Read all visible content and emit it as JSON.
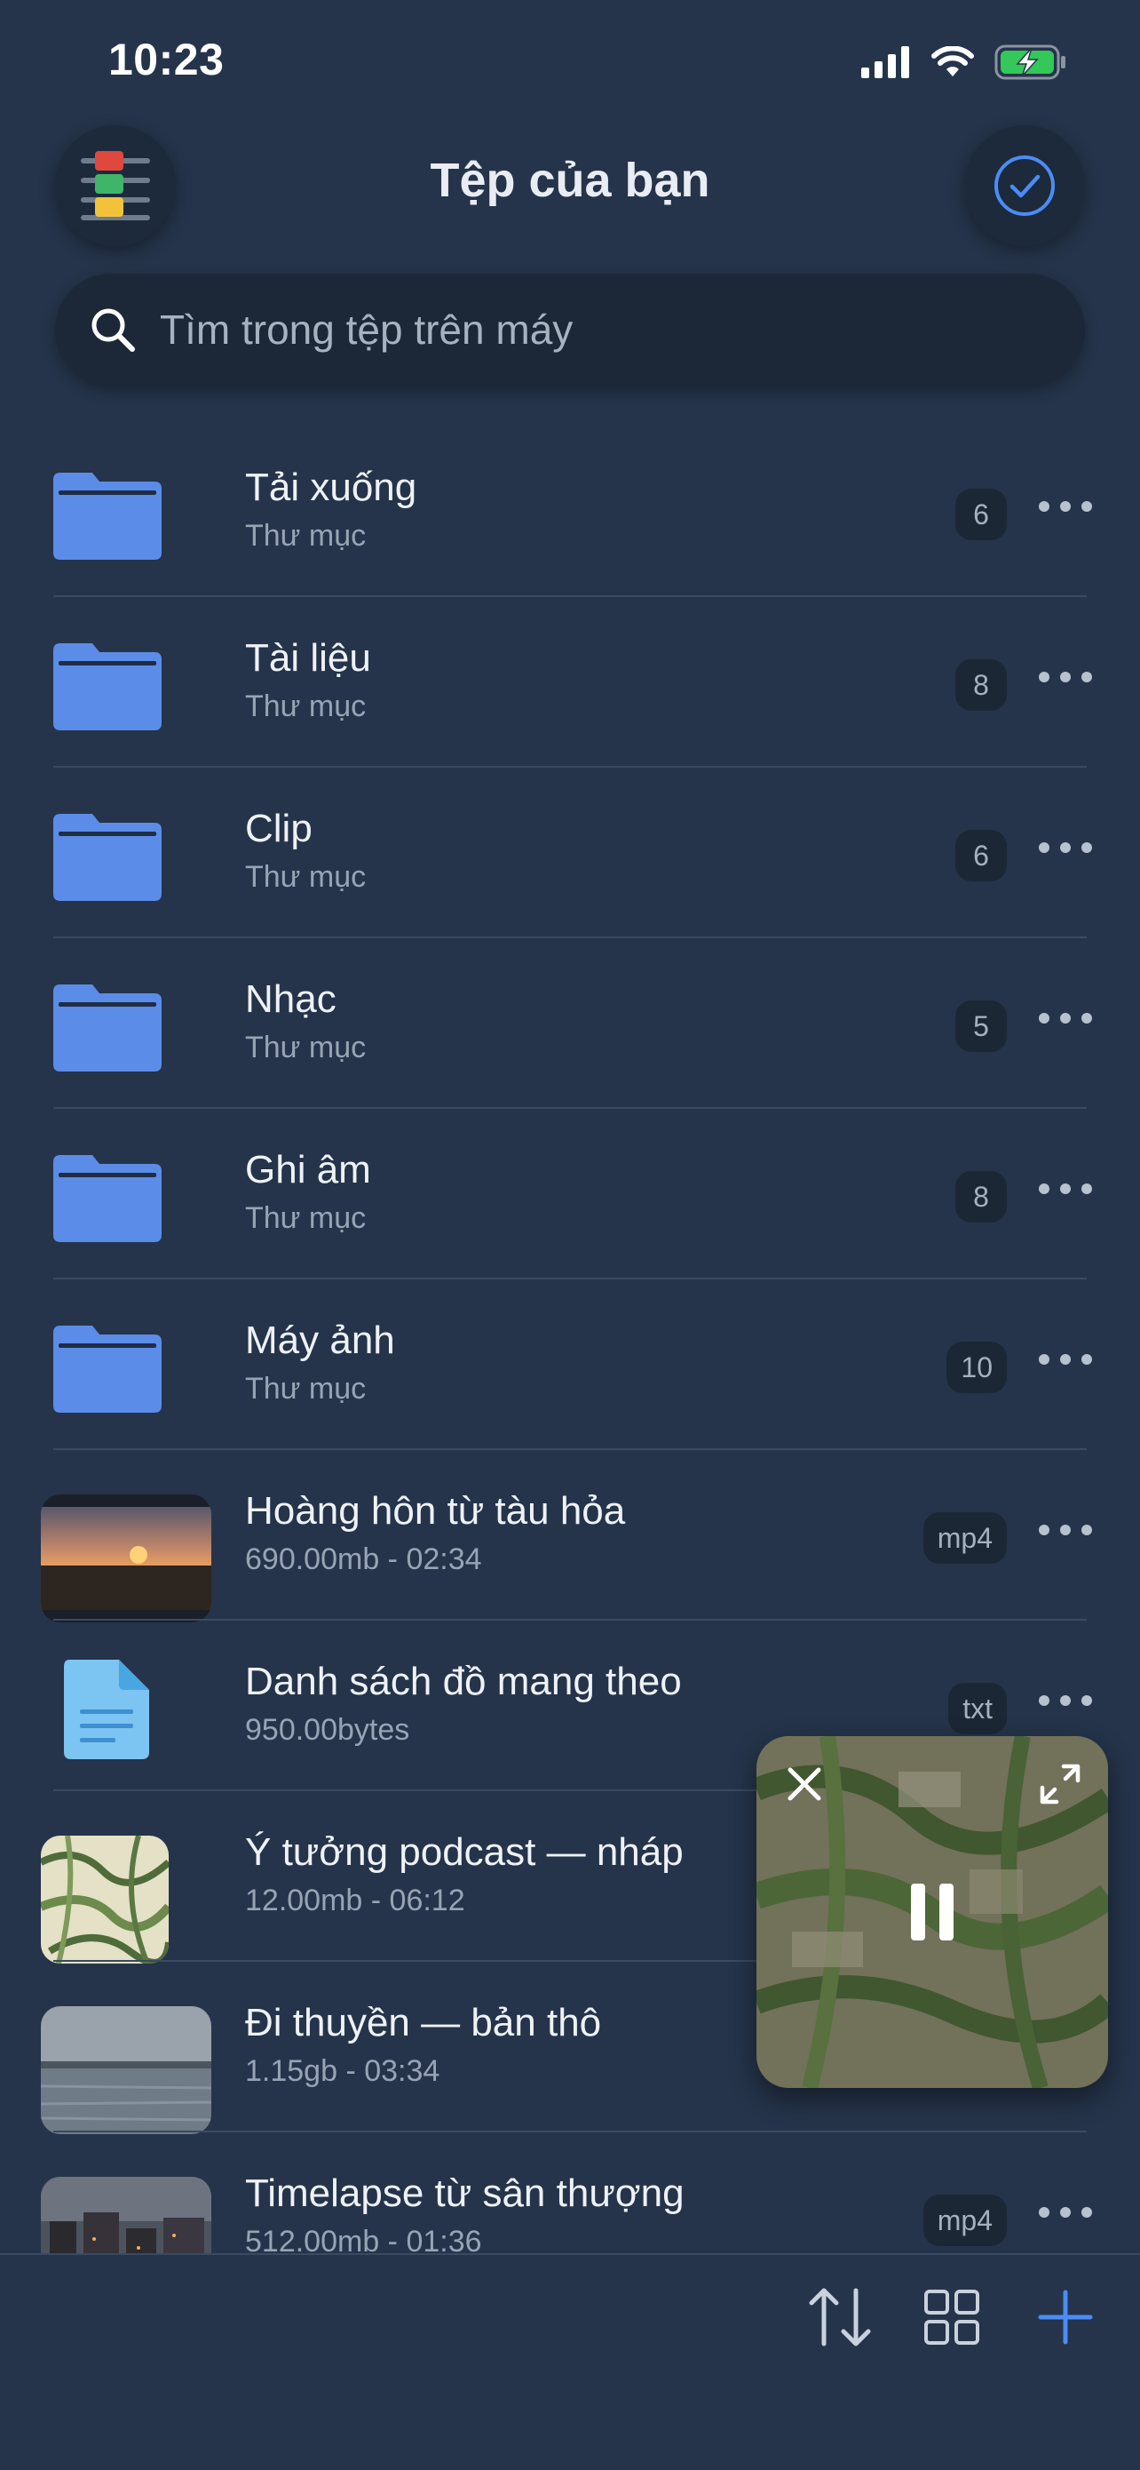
{
  "status": {
    "time": "10:23"
  },
  "header": {
    "title": "Tệp của bạn",
    "menu_icon": "stacked-lines-icon",
    "select_icon": "check-circle-icon"
  },
  "search": {
    "placeholder": "Tìm trong tệp trên máy",
    "value": ""
  },
  "files": [
    {
      "name": "Tải xuống",
      "sub": "Thư mục",
      "badge": "6",
      "kind": "folder"
    },
    {
      "name": "Tài liệu",
      "sub": "Thư mục",
      "badge": "8",
      "kind": "folder"
    },
    {
      "name": "Clip",
      "sub": "Thư mục",
      "badge": "6",
      "kind": "folder"
    },
    {
      "name": "Nhạc",
      "sub": "Thư mục",
      "badge": "5",
      "kind": "folder"
    },
    {
      "name": "Ghi âm",
      "sub": "Thư mục",
      "badge": "8",
      "kind": "folder"
    },
    {
      "name": "Máy ảnh",
      "sub": "Thư mục",
      "badge": "10",
      "kind": "folder"
    },
    {
      "name": "Hoàng hôn từ tàu hỏa",
      "sub": "690.00mb - 02:34",
      "badge": "mp4",
      "kind": "video-sunset"
    },
    {
      "name": "Danh sách đồ mang theo",
      "sub": "950.00bytes",
      "badge": "txt",
      "kind": "text-file"
    },
    {
      "name": "Ý tưởng podcast — nháp",
      "sub": "12.00mb - 06:12",
      "badge": "",
      "kind": "audio-pattern"
    },
    {
      "name": "Đi thuyền — bản thô",
      "sub": "1.15gb - 03:34",
      "badge": "",
      "kind": "video-lake"
    },
    {
      "name": "Timelapse từ sân thượng",
      "sub": "512.00mb - 01:36",
      "badge": "mp4",
      "kind": "video-city"
    }
  ],
  "player": {
    "state": "playing",
    "close_icon": "close-icon",
    "expand_icon": "expand-icon",
    "pause_icon": "pause-icon"
  },
  "toolbar": {
    "sort_icon": "sort-arrows-icon",
    "grid_icon": "grid-view-icon",
    "add_icon": "plus-icon"
  },
  "colors": {
    "background": "#25344a",
    "folder": "#5b8de8",
    "accent": "#4b8cf5",
    "battery": "#34c759"
  }
}
